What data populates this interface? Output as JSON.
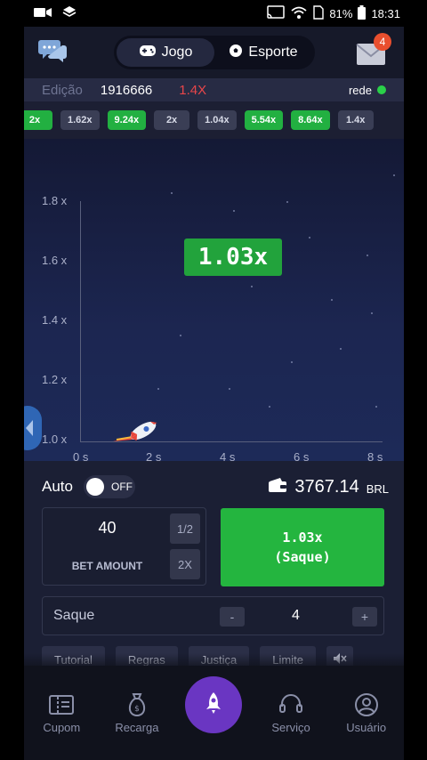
{
  "status_bar": {
    "battery": "81%",
    "time": "18:31"
  },
  "header": {
    "tabs": [
      {
        "label": "Jogo",
        "icon": "gamepad-icon",
        "active": true
      },
      {
        "label": "Esporte",
        "icon": "soccer-ball-icon",
        "active": false
      }
    ],
    "mail_badge": "4"
  },
  "edition": {
    "label": "Edição",
    "number": "1916666",
    "last_multiplier": "1.4X",
    "network_label": "rede",
    "network_status_color": "#2ad049"
  },
  "history": [
    {
      "value": "2x",
      "color": "green"
    },
    {
      "value": "1.62x",
      "color": "gray"
    },
    {
      "value": "9.24x",
      "color": "green"
    },
    {
      "value": "2x",
      "color": "gray"
    },
    {
      "value": "1.04x",
      "color": "gray"
    },
    {
      "value": "5.54x",
      "color": "green"
    },
    {
      "value": "8.64x",
      "color": "green"
    },
    {
      "value": "1.4x",
      "color": "gray"
    }
  ],
  "graph": {
    "current_multiplier": "1.03x",
    "y_ticks": [
      "1.8 x",
      "1.6 x",
      "1.4 x",
      "1.2 x",
      "1.0 x"
    ],
    "x_ticks": [
      "0 s",
      "2 s",
      "4 s",
      "6 s",
      "8 s"
    ]
  },
  "controls": {
    "auto_label": "Auto",
    "auto_toggle": "OFF",
    "balance": "3767.14",
    "currency": "BRL",
    "bet_value": "40",
    "bet_label": "BET AMOUNT",
    "half_label": "1/2",
    "double_label": "2X",
    "cashout_multiplier": "1.03x",
    "cashout_label": "(Saque)",
    "saque_label": "Saque",
    "saque_minus": "-",
    "saque_value": "4",
    "saque_plus": "+",
    "links": [
      "Tutorial",
      "Regras",
      "Justiça",
      "Limite"
    ]
  },
  "bottom_nav": [
    {
      "label": "Cupom",
      "icon": "ticket-icon"
    },
    {
      "label": "Recarga",
      "icon": "money-bag-icon"
    },
    {
      "label": "Serviço",
      "icon": "headset-icon"
    },
    {
      "label": "Usuário",
      "icon": "user-icon"
    }
  ],
  "colors": {
    "accent_green": "#24b53f",
    "accent_red": "#e8464a",
    "fab_purple": "#6a36c2"
  }
}
